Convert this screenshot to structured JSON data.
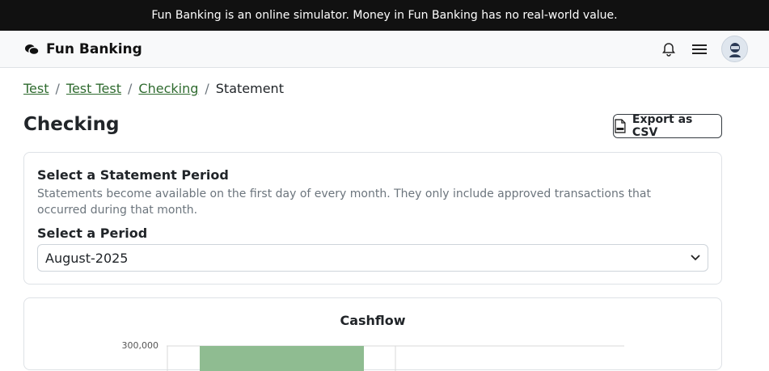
{
  "banner": {
    "text": "Fun Banking is an online simulator. Money in Fun Banking has no real-world value."
  },
  "navbar": {
    "brand": "Fun Banking"
  },
  "breadcrumb": {
    "items": [
      "Test",
      "Test Test",
      "Checking"
    ],
    "current": "Statement",
    "separator": "/"
  },
  "page": {
    "title": "Checking",
    "export_label": "Export as CSV"
  },
  "statement": {
    "heading": "Select a Statement Period",
    "description": "Statements become available on the first day of every month. They only include approved transactions that occurred during that month.",
    "period_label": "Select a Period",
    "period_value": "August-2025"
  },
  "chart_data": {
    "type": "bar",
    "title": "Cashflow",
    "y_ticks": [
      "300,000"
    ],
    "ylim_visible_top": 300000,
    "bar_color": "#8fbc91"
  },
  "colors": {
    "banner": "#111111",
    "link": "#2f6b2f"
  }
}
